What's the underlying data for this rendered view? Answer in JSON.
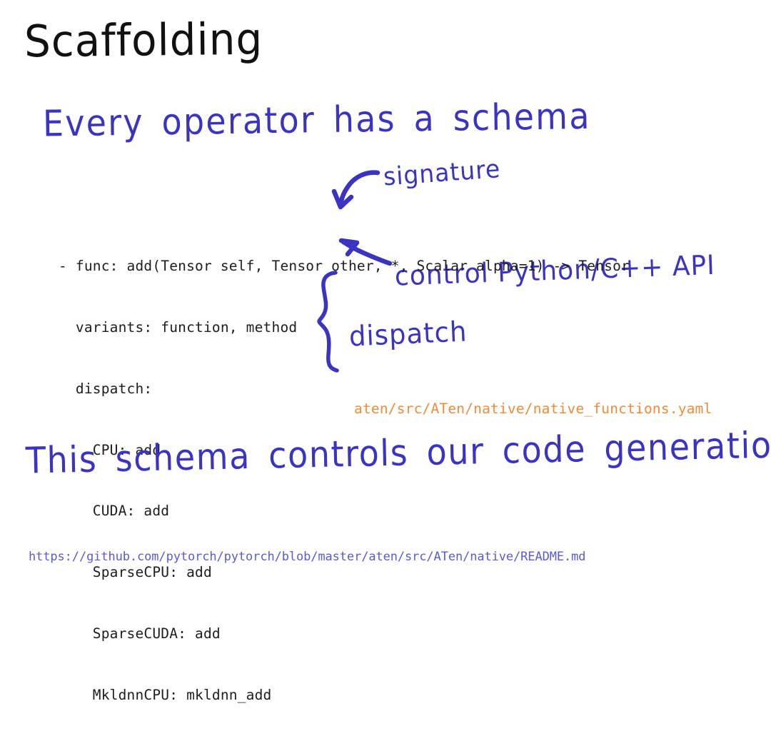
{
  "slide": {
    "title": "Scaffolding",
    "headline": "Every operator has a schema",
    "closing": "This schema controls our code generation",
    "background_color": "#ffffff",
    "ink_color": "#3b34c0",
    "title_color": "#111111",
    "path_color": "#ee8c3c",
    "url_color": "#5c5ad4",
    "code_color": "#1d1d1d"
  },
  "code": {
    "language": "yaml",
    "lines": [
      "- func: add(Tensor self, Tensor other, *, Scalar alpha=1) -> Tensor",
      "  variants: function, method",
      "  dispatch:",
      "    CPU: add",
      "    CUDA: add",
      "    SparseCPU: add",
      "    SparseCUDA: add",
      "    MkldnnCPU: mkldnn_add"
    ]
  },
  "annotations": {
    "signature": "signature",
    "control": "control Python/C++ API",
    "dispatch": "dispatch"
  },
  "file_path": "aten/src/ATen/native/native_functions.yaml",
  "footer_url": "https://github.com/pytorch/pytorch/blob/master/aten/src/ATen/native/README.md"
}
